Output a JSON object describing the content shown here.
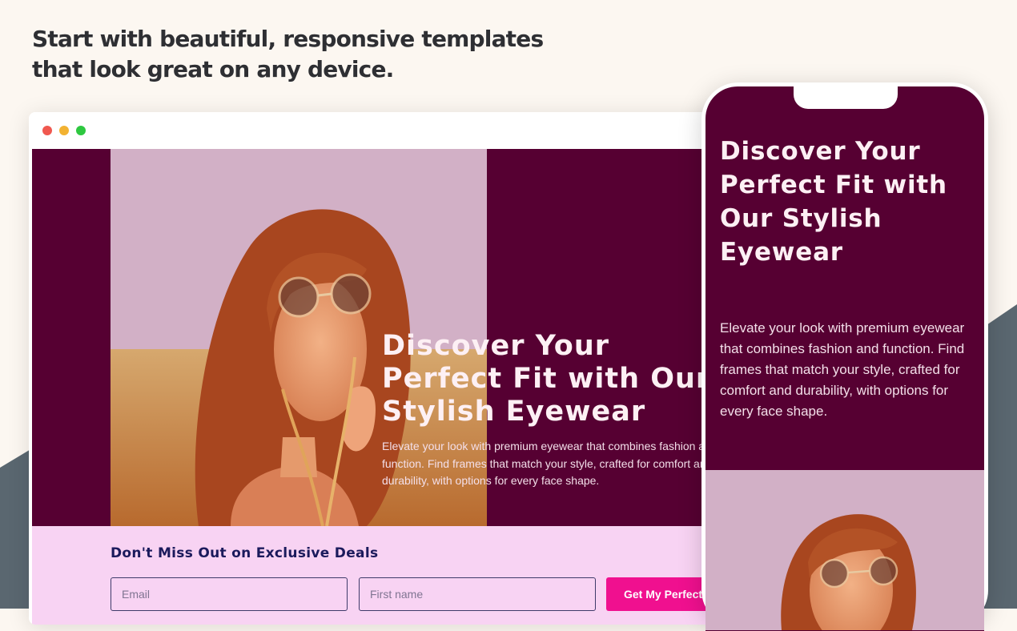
{
  "page": {
    "headline_line1": "Start with beautiful, responsive templates",
    "headline_line2": "that look great on any device."
  },
  "desktop": {
    "hero": {
      "title": "Discover Your Perfect Fit with Our Stylish Eyewear",
      "description": "Elevate your look with premium eyewear that combines fashion and function. Find frames that match your style, crafted for comfort and durability, with options for every face shape."
    },
    "deals": {
      "title": "Don't Miss Out on Exclusive Deals",
      "email_placeholder": "Email",
      "first_name_placeholder": "First name",
      "button_label": "Get My Perfect"
    }
  },
  "mobile": {
    "hero": {
      "title": "Discover Your Perfect Fit with Our Stylish Eyewear",
      "description": "Elevate your look with premium eyewear that combines fashion and function. Find frames that match your style, crafted for comfort and durability, with options for every face shape."
    }
  },
  "colors": {
    "page_bg": "#fcf7f1",
    "hero_bg": "#560032",
    "deals_bg": "#f8d3f3",
    "cta": "#f0108f",
    "heading_dark": "#1b1a5c",
    "slate": "#5a6770"
  }
}
